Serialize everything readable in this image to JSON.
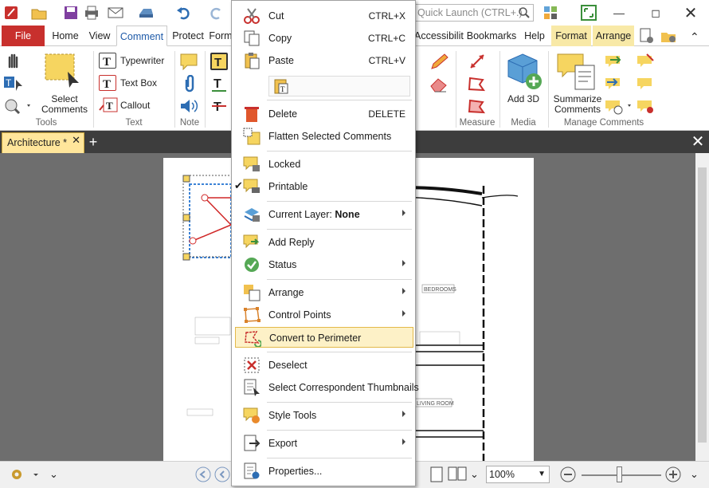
{
  "quick_launch": {
    "placeholder": "Quick Launch (CTRL+.)"
  },
  "ribbon_tabs": {
    "file": "File",
    "home": "Home",
    "view": "View",
    "comment": "Comment",
    "protect": "Protect",
    "form": "Form",
    "accessibility": "Accessibility",
    "bookmarks": "Bookmarks",
    "help": "Help",
    "format": "Format",
    "arrange": "Arrange"
  },
  "ribbon": {
    "tools_group": {
      "label": "Tools",
      "select_comments": "Select Comments"
    },
    "text_group": {
      "label": "Text",
      "typewriter": "Typewriter",
      "text_box": "Text Box",
      "callout": "Callout"
    },
    "note_group": {
      "label": "Note"
    },
    "measure_group": {
      "label": "Measure"
    },
    "media_group": {
      "label": "Media",
      "add_3d": "Add 3D"
    },
    "manage_group": {
      "label": "Manage Comments",
      "summarize": "Summarize Comments"
    }
  },
  "document": {
    "tab_title": "Architecture *"
  },
  "drawing_labels": {
    "bedrooms": "BEDROOMS",
    "living_room": "LIVING ROOM"
  },
  "context_menu": {
    "cut": {
      "label": "Cut",
      "shortcut": "CTRL+X"
    },
    "copy": {
      "label": "Copy",
      "shortcut": "CTRL+C"
    },
    "paste": {
      "label": "Paste",
      "shortcut": "CTRL+V"
    },
    "delete": {
      "label": "Delete",
      "shortcut": "DELETE"
    },
    "flatten": {
      "label": "Flatten Selected Comments"
    },
    "locked": {
      "label": "Locked"
    },
    "printable": {
      "label": "Printable"
    },
    "current_layer": {
      "label": "Current Layer:",
      "value": "None"
    },
    "add_reply": {
      "label": "Add Reply"
    },
    "status": {
      "label": "Status"
    },
    "arrange": {
      "label": "Arrange"
    },
    "control_points": {
      "label": "Control Points"
    },
    "convert_perimeter": {
      "label": "Convert to Perimeter"
    },
    "deselect": {
      "label": "Deselect"
    },
    "select_thumbnails": {
      "label": "Select Correspondent Thumbnails"
    },
    "style_tools": {
      "label": "Style Tools"
    },
    "export": {
      "label": "Export"
    },
    "properties": {
      "label": "Properties..."
    }
  },
  "statusbar": {
    "zoom": "100%"
  },
  "colors": {
    "file_tab": "#c8302d",
    "active_tab_text": "#1e5aa8",
    "doc_tab": "#ffe69b",
    "menu_highlight": "#fdf1c7",
    "workspace": "#6e6e6e"
  }
}
